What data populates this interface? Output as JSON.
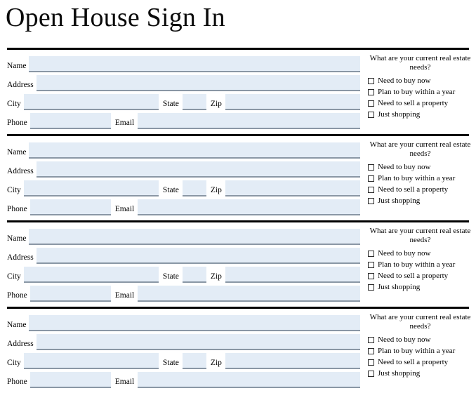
{
  "document": {
    "title": "Open House Sign In"
  },
  "form": {
    "labels": {
      "name": "Name",
      "address": "Address",
      "city": "City",
      "state": "State",
      "zip": "Zip",
      "phone": "Phone",
      "email": "Email"
    },
    "needs": {
      "question": "What are your current real estate needs?",
      "options": [
        "Need to buy now",
        "Plan to buy within a year",
        "Need to sell a property",
        "Just shopping"
      ]
    },
    "entries": [
      {
        "name": "",
        "address": "",
        "city": "",
        "state": "",
        "zip": "",
        "phone": "",
        "email": "",
        "checked": [
          false,
          false,
          false,
          false
        ]
      },
      {
        "name": "",
        "address": "",
        "city": "",
        "state": "",
        "zip": "",
        "phone": "",
        "email": "",
        "checked": [
          false,
          false,
          false,
          false
        ]
      },
      {
        "name": "",
        "address": "",
        "city": "",
        "state": "",
        "zip": "",
        "phone": "",
        "email": "",
        "checked": [
          false,
          false,
          false,
          false
        ]
      },
      {
        "name": "",
        "address": "",
        "city": "",
        "state": "",
        "zip": "",
        "phone": "",
        "email": "",
        "checked": [
          false,
          false,
          false,
          false
        ]
      }
    ]
  },
  "colors": {
    "field_fill": "#e3ecf6",
    "field_underline": "#8a97a5",
    "separator": "#000000",
    "page_background": "#ffffff",
    "text": "#000000"
  }
}
